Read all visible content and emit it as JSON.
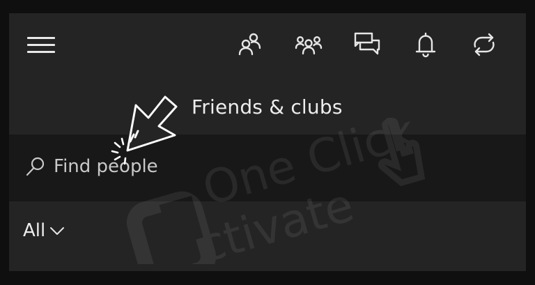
{
  "header": {
    "icons": [
      {
        "name": "friends-icon"
      },
      {
        "name": "parties-icon"
      },
      {
        "name": "chat-icon"
      },
      {
        "name": "notifications-icon"
      },
      {
        "name": "sync-icon"
      }
    ]
  },
  "page": {
    "title": "Friends & clubs"
  },
  "search": {
    "placeholder": "Find people"
  },
  "filter": {
    "label": "All"
  },
  "watermark": {
    "line1": "One Click",
    "line2": "ctivate"
  },
  "colors": {
    "background": "#242424",
    "search_bg": "#181818",
    "text": "#ededed"
  }
}
